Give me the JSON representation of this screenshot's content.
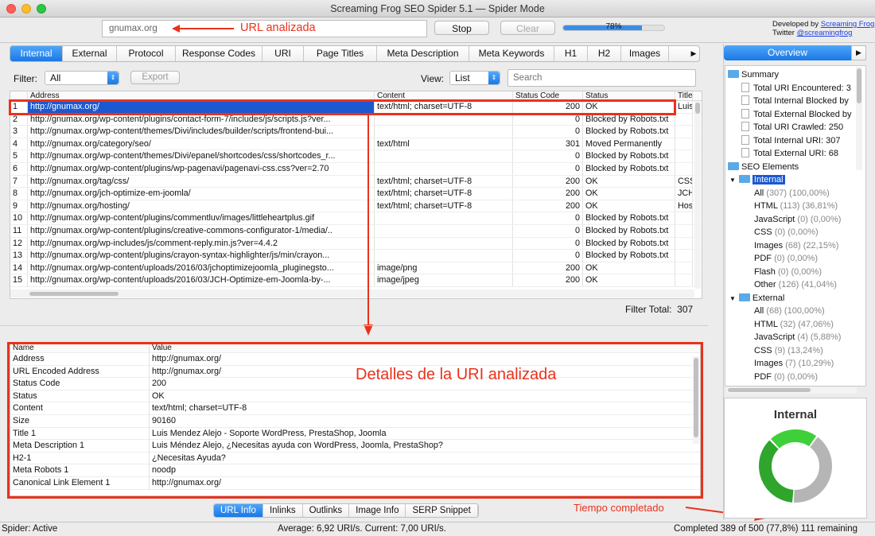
{
  "window": {
    "title": "Screaming Frog SEO Spider 5.1 — Spider Mode"
  },
  "toolbar": {
    "url": "gnumax.org",
    "url_annotation": "URL analizada",
    "stop_label": "Stop",
    "clear_label": "Clear",
    "progress_label": "78%",
    "progress_fraction": 0.78,
    "developed_by": "Developed by",
    "developer_link": "Screaming Frog",
    "twitter_label": "Twitter",
    "twitter_link": "@screamingfrog"
  },
  "tabs": [
    "Internal",
    "External",
    "Protocol",
    "Response Codes",
    "URI",
    "Page Titles",
    "Meta Description",
    "Meta Keywords",
    "H1",
    "H2",
    "Images"
  ],
  "filter": {
    "label": "Filter:",
    "value": "All",
    "export_label": "Export",
    "view_label": "View:",
    "view_value": "List",
    "search_placeholder": "Search"
  },
  "grid": {
    "headers": {
      "address": "Address",
      "content": "Content",
      "status_code": "Status Code",
      "status": "Status",
      "title": "Title"
    },
    "rows": [
      {
        "n": "1",
        "addr": "http://gnumax.org/",
        "content": "text/html; charset=UTF-8",
        "code": "200",
        "status": "OK",
        "title": "Luis"
      },
      {
        "n": "2",
        "addr": "http://gnumax.org/wp-content/plugins/contact-form-7/includes/js/scripts.js?ver...",
        "content": "",
        "code": "0",
        "status": "Blocked by Robots.txt",
        "title": ""
      },
      {
        "n": "3",
        "addr": "http://gnumax.org/wp-content/themes/Divi/includes/builder/scripts/frontend-bui...",
        "content": "",
        "code": "0",
        "status": "Blocked by Robots.txt",
        "title": ""
      },
      {
        "n": "4",
        "addr": "http://gnumax.org/category/seo/",
        "content": "text/html",
        "code": "301",
        "status": "Moved Permanently",
        "title": ""
      },
      {
        "n": "5",
        "addr": "http://gnumax.org/wp-content/themes/Divi/epanel/shortcodes/css/shortcodes_r...",
        "content": "",
        "code": "0",
        "status": "Blocked by Robots.txt",
        "title": ""
      },
      {
        "n": "6",
        "addr": "http://gnumax.org/wp-content/plugins/wp-pagenavi/pagenavi-css.css?ver=2.70",
        "content": "",
        "code": "0",
        "status": "Blocked by Robots.txt",
        "title": ""
      },
      {
        "n": "7",
        "addr": "http://gnumax.org/tag/css/",
        "content": "text/html; charset=UTF-8",
        "code": "200",
        "status": "OK",
        "title": "CSS"
      },
      {
        "n": "8",
        "addr": "http://gnumax.org/jch-optimize-em-joomla/",
        "content": "text/html; charset=UTF-8",
        "code": "200",
        "status": "OK",
        "title": "JCH"
      },
      {
        "n": "9",
        "addr": "http://gnumax.org/hosting/",
        "content": "text/html; charset=UTF-8",
        "code": "200",
        "status": "OK",
        "title": "Hos"
      },
      {
        "n": "10",
        "addr": "http://gnumax.org/wp-content/plugins/commentluv/images/littleheartplus.gif",
        "content": "",
        "code": "0",
        "status": "Blocked by Robots.txt",
        "title": ""
      },
      {
        "n": "11",
        "addr": "http://gnumax.org/wp-content/plugins/creative-commons-configurator-1/media/..",
        "content": "",
        "code": "0",
        "status": "Blocked by Robots.txt",
        "title": ""
      },
      {
        "n": "12",
        "addr": "http://gnumax.org/wp-includes/js/comment-reply.min.js?ver=4.4.2",
        "content": "",
        "code": "0",
        "status": "Blocked by Robots.txt",
        "title": ""
      },
      {
        "n": "13",
        "addr": "http://gnumax.org/wp-content/plugins/crayon-syntax-highlighter/js/min/crayon...",
        "content": "",
        "code": "0",
        "status": "Blocked by Robots.txt",
        "title": ""
      },
      {
        "n": "14",
        "addr": "http://gnumax.org/wp-content/uploads/2016/03/jchoptimizejoomla_pluginegsto...",
        "content": "image/png",
        "code": "200",
        "status": "OK",
        "title": ""
      },
      {
        "n": "15",
        "addr": "http://gnumax.org/wp-content/uploads/2016/03/JCH-Optimize-em-Joomla-by-...",
        "content": "image/jpeg",
        "code": "200",
        "status": "OK",
        "title": ""
      }
    ],
    "filter_total_label": "Filter Total:",
    "filter_total": "307"
  },
  "details": {
    "annotation": "Detalles de la URI analizada",
    "headers": {
      "name": "Name",
      "value": "Value"
    },
    "rows": [
      {
        "name": "Address",
        "value": "http://gnumax.org/"
      },
      {
        "name": "URL Encoded Address",
        "value": "http://gnumax.org/"
      },
      {
        "name": "Status Code",
        "value": "200"
      },
      {
        "name": "Status",
        "value": "OK"
      },
      {
        "name": "Content",
        "value": "text/html; charset=UTF-8"
      },
      {
        "name": "Size",
        "value": "90160"
      },
      {
        "name": "Title 1",
        "value": "Luis Mendez Alejo - Soporte WordPress, PrestaShop, Joomla"
      },
      {
        "name": "Meta Description 1",
        "value": "Luis Méndez Alejo, ¿Necesitas ayuda con WordPress, Joomla, PrestaShop?"
      },
      {
        "name": "H2-1",
        "value": "¿Necesitas Ayuda?"
      },
      {
        "name": "Meta Robots 1",
        "value": "noodp"
      },
      {
        "name": "Canonical Link Element 1",
        "value": "http://gnumax.org/"
      }
    ]
  },
  "bottom_tabs": [
    "URL Info",
    "Inlinks",
    "Outlinks",
    "Image Info",
    "SERP Snippet"
  ],
  "time_annotation": "Tiempo completado",
  "status": {
    "left": "Spider: Active",
    "middle": "Average: 6,92 URI/s. Current: 7,00 URI/s.",
    "right": "Completed 389 of 500 (77,8%) 111 remaining"
  },
  "overview": {
    "label": "Overview",
    "summary_label": "Summary",
    "summary": [
      "Total URI Encountered: 3",
      "Total Internal Blocked by",
      "Total External Blocked by",
      "Total URI Crawled: 250",
      "Total Internal URI: 307",
      "Total External URI: 68"
    ],
    "seo_label": "SEO Elements",
    "internal_label": "Internal",
    "internal": [
      {
        "name": "All",
        "stat": "(307) (100,00%)"
      },
      {
        "name": "HTML",
        "stat": "(113) (36,81%)"
      },
      {
        "name": "JavaScript",
        "stat": "(0) (0,00%)"
      },
      {
        "name": "CSS",
        "stat": "(0) (0,00%)"
      },
      {
        "name": "Images",
        "stat": "(68) (22,15%)"
      },
      {
        "name": "PDF",
        "stat": "(0) (0,00%)"
      },
      {
        "name": "Flash",
        "stat": "(0) (0,00%)"
      },
      {
        "name": "Other",
        "stat": "(126) (41,04%)"
      }
    ],
    "external_label": "External",
    "external": [
      {
        "name": "All",
        "stat": "(68) (100,00%)"
      },
      {
        "name": "HTML",
        "stat": "(32) (47,06%)"
      },
      {
        "name": "JavaScript",
        "stat": "(4) (5,88%)"
      },
      {
        "name": "CSS",
        "stat": "(9) (13,24%)"
      },
      {
        "name": "Images",
        "stat": "(7) (10,29%)"
      },
      {
        "name": "PDF",
        "stat": "(0) (0,00%)"
      }
    ],
    "chart_title": "Internal"
  },
  "chart_data": {
    "type": "pie",
    "title": "Internal",
    "categories": [
      "HTML",
      "Images",
      "Other"
    ],
    "values": [
      36.81,
      22.15,
      41.04
    ],
    "colors": [
      "#2fa52c",
      "#3fcf3a",
      "#b5b5b5"
    ]
  }
}
